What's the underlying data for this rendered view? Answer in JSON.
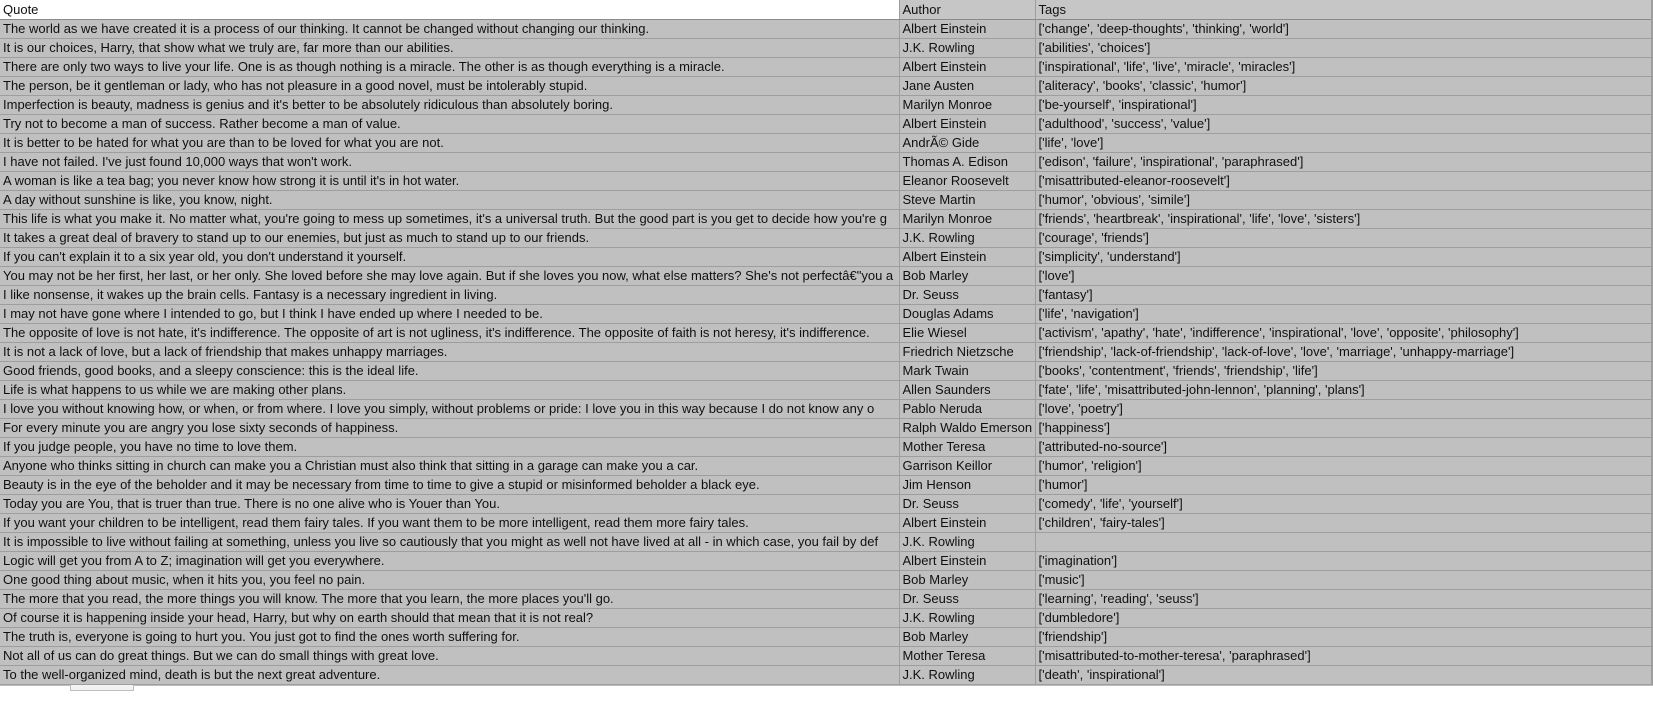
{
  "columns": {
    "quote": "Quote",
    "author": "Author",
    "tags": "Tags"
  },
  "rows": [
    {
      "quote": "The world as we have created it is a process of our thinking. It cannot be changed without changing our thinking.",
      "author": "Albert Einstein",
      "tags": "['change', 'deep-thoughts', 'thinking', 'world']"
    },
    {
      "quote": "It is our choices, Harry, that show what we truly are, far more than our abilities.",
      "author": "J.K. Rowling",
      "tags": "['abilities', 'choices']"
    },
    {
      "quote": "There are only two ways to live your life. One is as though nothing is a miracle. The other is as though everything is a miracle.",
      "author": "Albert Einstein",
      "tags": "['inspirational', 'life', 'live', 'miracle', 'miracles']"
    },
    {
      "quote": "The person, be it gentleman or lady, who has not pleasure in a good novel, must be intolerably stupid.",
      "author": "Jane Austen",
      "tags": "['aliteracy', 'books', 'classic', 'humor']"
    },
    {
      "quote": "Imperfection is beauty, madness is genius and it's better to be absolutely ridiculous than absolutely boring.",
      "author": "Marilyn Monroe",
      "tags": "['be-yourself', 'inspirational']"
    },
    {
      "quote": "Try not to become a man of success. Rather become a man of value.",
      "author": "Albert Einstein",
      "tags": "['adulthood', 'success', 'value']"
    },
    {
      "quote": "It is better to be hated for what you are than to be loved for what you are not.",
      "author": "AndrÃ© Gide",
      "tags": "['life', 'love']"
    },
    {
      "quote": "I have not failed. I've just found 10,000 ways that won't work.",
      "author": "Thomas A. Edison",
      "tags": "['edison', 'failure', 'inspirational', 'paraphrased']"
    },
    {
      "quote": "A woman is like a tea bag; you never know how strong it is until it's in hot water.",
      "author": "Eleanor Roosevelt",
      "tags": "['misattributed-eleanor-roosevelt']"
    },
    {
      "quote": "A day without sunshine is like, you know, night.",
      "author": "Steve Martin",
      "tags": "['humor', 'obvious', 'simile']"
    },
    {
      "quote": "This life is what you make it. No matter what, you're going to mess up sometimes, it's a universal truth. But the good part is you get to decide how you're g",
      "author": "Marilyn Monroe",
      "tags": "['friends', 'heartbreak', 'inspirational', 'life', 'love', 'sisters']"
    },
    {
      "quote": "It takes a great deal of bravery to stand up to our enemies, but just as much to stand up to our friends.",
      "author": "J.K. Rowling",
      "tags": "['courage', 'friends']"
    },
    {
      "quote": "If you can't explain it to a six year old, you don't understand it yourself.",
      "author": "Albert Einstein",
      "tags": "['simplicity', 'understand']"
    },
    {
      "quote": "You may not be her first, her last, or her only. She loved before she may love again. But if she loves you now, what else matters? She's not perfectâ€\"you a",
      "author": "Bob Marley",
      "tags": "['love']"
    },
    {
      "quote": "I like nonsense, it wakes up the brain cells. Fantasy is a necessary ingredient in living.",
      "author": "Dr. Seuss",
      "tags": "['fantasy']"
    },
    {
      "quote": "I may not have gone where I intended to go, but I think I have ended up where I needed to be.",
      "author": "Douglas Adams",
      "tags": "['life', 'navigation']"
    },
    {
      "quote": "The opposite of love is not hate, it's indifference. The opposite of art is not ugliness, it's indifference. The opposite of faith is not heresy, it's indifference.",
      "author": "Elie Wiesel",
      "tags": "['activism', 'apathy', 'hate', 'indifference', 'inspirational', 'love', 'opposite', 'philosophy']"
    },
    {
      "quote": "It is not a lack of love, but a lack of friendship that makes unhappy marriages.",
      "author": "Friedrich Nietzsche",
      "tags": "['friendship', 'lack-of-friendship', 'lack-of-love', 'love', 'marriage', 'unhappy-marriage']"
    },
    {
      "quote": "Good friends, good books, and a sleepy conscience: this is the ideal life.",
      "author": "Mark Twain",
      "tags": "['books', 'contentment', 'friends', 'friendship', 'life']"
    },
    {
      "quote": "Life is what happens to us while we are making other plans.",
      "author": "Allen Saunders",
      "tags": "['fate', 'life', 'misattributed-john-lennon', 'planning', 'plans']"
    },
    {
      "quote": "I love you without knowing how, or when, or from where. I love you simply, without problems or pride: I love you in this way because I do not know any o",
      "author": "Pablo Neruda",
      "tags": "['love', 'poetry']"
    },
    {
      "quote": "For every minute you are angry you lose sixty seconds of happiness.",
      "author": "Ralph Waldo Emerson",
      "tags": "['happiness']"
    },
    {
      "quote": "If you judge people, you have no time to love them.",
      "author": "Mother Teresa",
      "tags": "['attributed-no-source']"
    },
    {
      "quote": "Anyone who thinks sitting in church can make you a Christian must also think that sitting in a garage can make you a car.",
      "author": "Garrison Keillor",
      "tags": "['humor', 'religion']"
    },
    {
      "quote": "Beauty is in the eye of the beholder and it may be necessary from time to time to give a stupid or misinformed beholder a black eye.",
      "author": "Jim Henson",
      "tags": "['humor']"
    },
    {
      "quote": "Today you are You, that is truer than true. There is no one alive who is Youer than You.",
      "author": "Dr. Seuss",
      "tags": "['comedy', 'life', 'yourself']"
    },
    {
      "quote": "If you want your children to be intelligent, read them fairy tales. If you want them to be more intelligent, read them more fairy tales.",
      "author": "Albert Einstein",
      "tags": "['children', 'fairy-tales']"
    },
    {
      "quote": "It is impossible to live without failing at something, unless you live so cautiously that you might as well not have lived at all - in which case, you fail by def",
      "author": "J.K. Rowling",
      "tags": ""
    },
    {
      "quote": "Logic will get you from A to Z; imagination will get you everywhere.",
      "author": "Albert Einstein",
      "tags": "['imagination']"
    },
    {
      "quote": "One good thing about music, when it hits you, you feel no pain.",
      "author": "Bob Marley",
      "tags": "['music']"
    },
    {
      "quote": "The more that you read, the more things you will know. The more that you learn, the more places you'll go.",
      "author": "Dr. Seuss",
      "tags": "['learning', 'reading', 'seuss']"
    },
    {
      "quote": "Of course it is happening inside your head, Harry, but why on earth should that mean that it is not real?",
      "author": "J.K. Rowling",
      "tags": "['dumbledore']"
    },
    {
      "quote": "The truth is, everyone is going to hurt you. You just got to find the ones worth suffering for.",
      "author": "Bob Marley",
      "tags": "['friendship']"
    },
    {
      "quote": "Not all of us can do great things. But we can do small things with great love.",
      "author": "Mother Teresa",
      "tags": "['misattributed-to-mother-teresa', 'paraphrased']"
    },
    {
      "quote": "To the well-organized mind, death is but the next great adventure.",
      "author": "J.K. Rowling",
      "tags": "['death', 'inspirational']"
    }
  ]
}
